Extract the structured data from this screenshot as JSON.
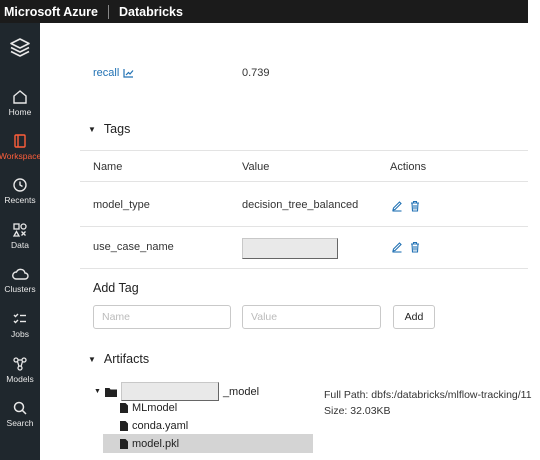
{
  "topbar": {
    "brand": "Microsoft Azure",
    "product": "Databricks"
  },
  "sidebar": {
    "items": [
      {
        "label": "Home",
        "icon": "home-icon"
      },
      {
        "label": "Workspace",
        "icon": "workspace-icon",
        "active": true
      },
      {
        "label": "Recents",
        "icon": "clock-icon"
      },
      {
        "label": "Data",
        "icon": "data-icon"
      },
      {
        "label": "Clusters",
        "icon": "cloud-icon"
      },
      {
        "label": "Jobs",
        "icon": "jobs-icon"
      },
      {
        "label": "Models",
        "icon": "models-icon"
      },
      {
        "label": "Search",
        "icon": "search-icon"
      }
    ]
  },
  "metrics": {
    "recall_name": "recall",
    "recall_value": "0.739"
  },
  "tags": {
    "title": "Tags",
    "columns": [
      "Name",
      "Value",
      "Actions"
    ],
    "rows": [
      {
        "name": "model_type",
        "value": "decision_tree_balanced"
      },
      {
        "name": "use_case_name",
        "value": ""
      }
    ]
  },
  "add_tag": {
    "title": "Add Tag",
    "name_placeholder": "Name",
    "value_placeholder": "Value",
    "button": "Add"
  },
  "artifacts": {
    "title": "Artifacts",
    "folder_suffix": "_model",
    "files": [
      "MLmodel",
      "conda.yaml",
      "model.pkl"
    ],
    "full_path_label": "Full Path:",
    "full_path_value": "dbfs:/databricks/mlflow-tracking/11",
    "size_label": "Size:",
    "size_value": "32.03KB"
  },
  "colors": {
    "topbar": "#1b1b1b",
    "sidebar": "#1f272d",
    "active": "#ff5e3a",
    "link": "#2272b4"
  }
}
